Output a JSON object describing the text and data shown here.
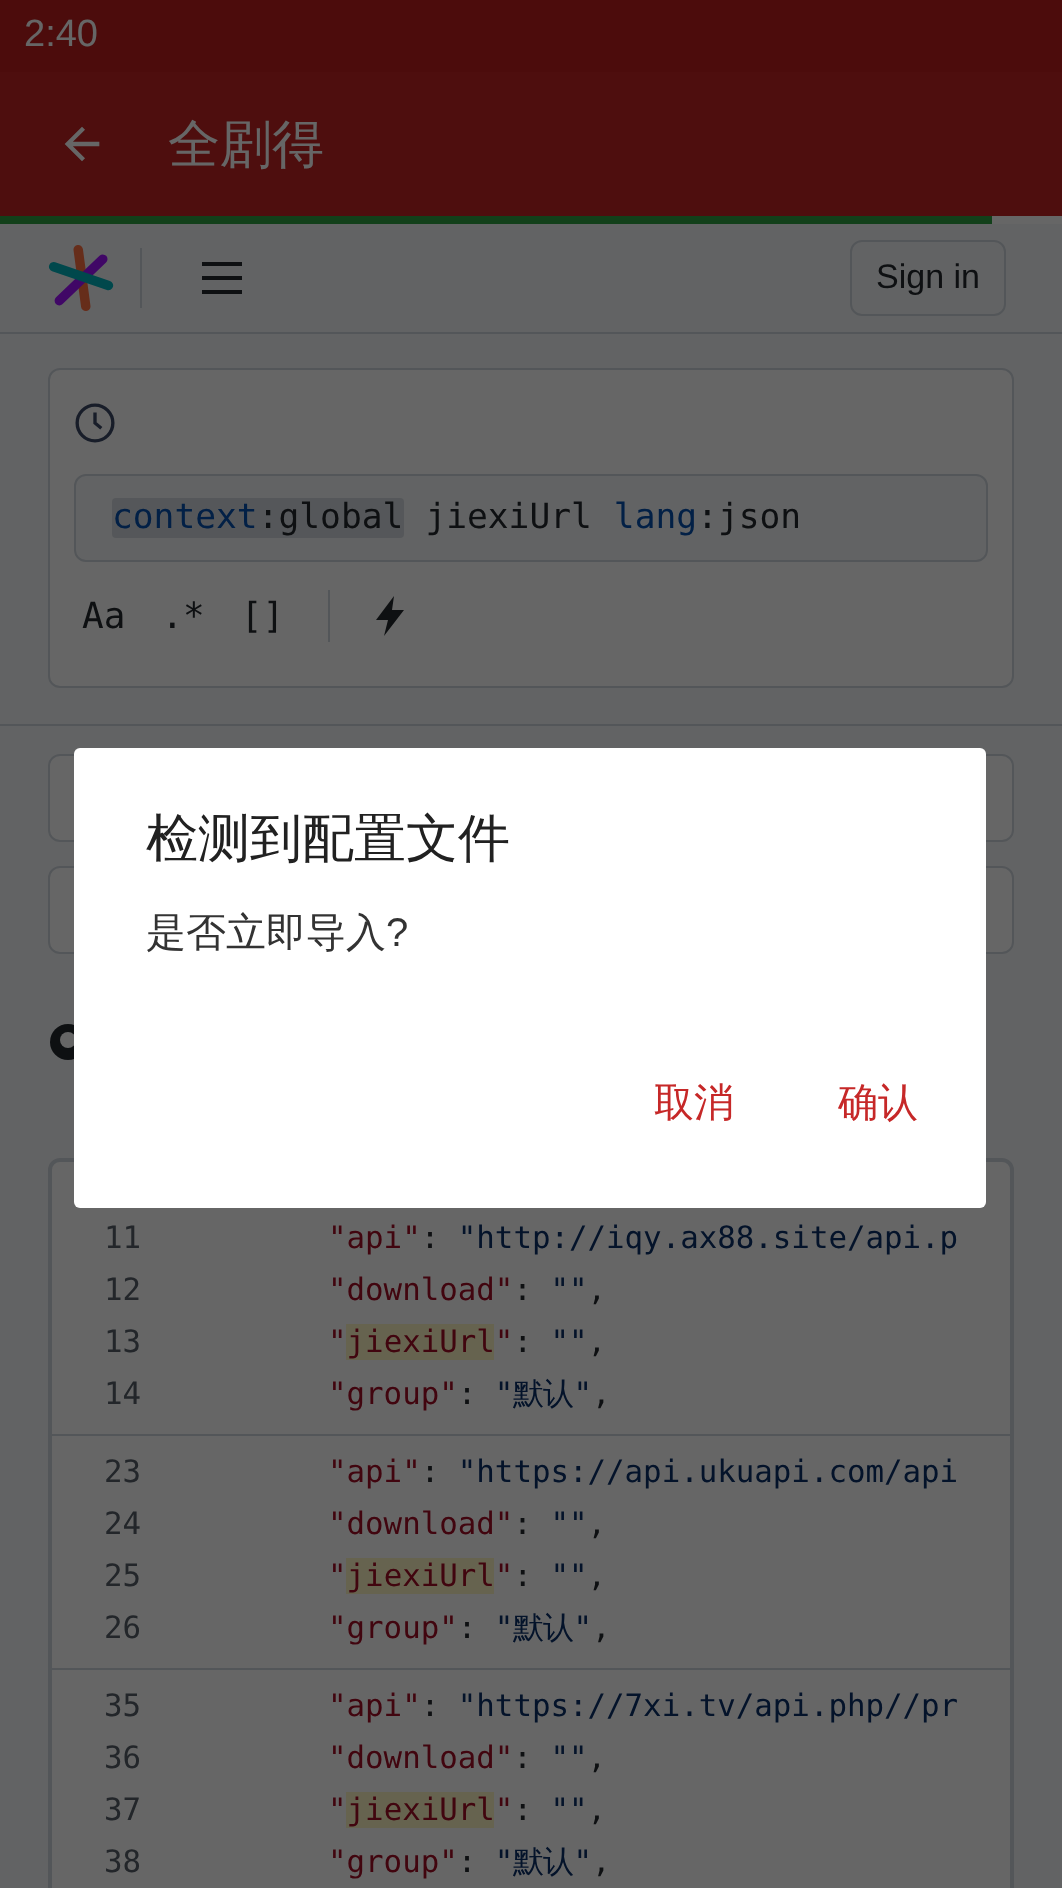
{
  "status_bar": {
    "time": "2:40"
  },
  "app_bar": {
    "title": "全剧得"
  },
  "page_progress": {
    "level": 0.935
  },
  "site_header": {
    "sign_in": "Sign in"
  },
  "search": {
    "query": [
      {
        "key": "context",
        "value": ":global",
        "chip": true
      },
      {
        "text": "jiexiUrl"
      },
      {
        "key": "lang",
        "value": ":json",
        "chip": false
      }
    ],
    "options": [
      "Aa",
      ".*",
      "[]"
    ]
  },
  "code_groups": [
    {
      "lines": [
        {
          "number": "11",
          "tokens": [
            {
              "kind": "key",
              "text": "\"api\""
            },
            {
              "kind": "punct",
              "text": ": "
            },
            {
              "kind": "string",
              "text": "\"http://iqy.ax88.site/api.p"
            }
          ]
        },
        {
          "number": "12",
          "tokens": [
            {
              "kind": "key",
              "text": "\"download\""
            },
            {
              "kind": "punct",
              "text": ": "
            },
            {
              "kind": "string",
              "text": "\"\""
            },
            {
              "kind": "punct",
              "text": ","
            }
          ]
        },
        {
          "number": "13",
          "tokens": [
            {
              "kind": "key",
              "text": "\""
            },
            {
              "kind": "match",
              "text": "jiexiUrl"
            },
            {
              "kind": "key",
              "text": "\""
            },
            {
              "kind": "punct",
              "text": ": "
            },
            {
              "kind": "string",
              "text": "\"\""
            },
            {
              "kind": "punct",
              "text": ","
            }
          ]
        },
        {
          "number": "14",
          "tokens": [
            {
              "kind": "key",
              "text": "\"group\""
            },
            {
              "kind": "punct",
              "text": ": "
            },
            {
              "kind": "string",
              "text": "\"默认\""
            },
            {
              "kind": "punct",
              "text": ","
            }
          ]
        }
      ]
    },
    {
      "lines": [
        {
          "number": "23",
          "tokens": [
            {
              "kind": "key",
              "text": "\"api\""
            },
            {
              "kind": "punct",
              "text": ": "
            },
            {
              "kind": "string",
              "text": "\"https://api.ukuapi.com/api"
            }
          ]
        },
        {
          "number": "24",
          "tokens": [
            {
              "kind": "key",
              "text": "\"download\""
            },
            {
              "kind": "punct",
              "text": ": "
            },
            {
              "kind": "string",
              "text": "\"\""
            },
            {
              "kind": "punct",
              "text": ","
            }
          ]
        },
        {
          "number": "25",
          "tokens": [
            {
              "kind": "key",
              "text": "\""
            },
            {
              "kind": "match",
              "text": "jiexiUrl"
            },
            {
              "kind": "key",
              "text": "\""
            },
            {
              "kind": "punct",
              "text": ": "
            },
            {
              "kind": "string",
              "text": "\"\""
            },
            {
              "kind": "punct",
              "text": ","
            }
          ]
        },
        {
          "number": "26",
          "tokens": [
            {
              "kind": "key",
              "text": "\"group\""
            },
            {
              "kind": "punct",
              "text": ": "
            },
            {
              "kind": "string",
              "text": "\"默认\""
            },
            {
              "kind": "punct",
              "text": ","
            }
          ]
        }
      ]
    },
    {
      "lines": [
        {
          "number": "35",
          "tokens": [
            {
              "kind": "key",
              "text": "\"api\""
            },
            {
              "kind": "punct",
              "text": ": "
            },
            {
              "kind": "string",
              "text": "\"https://7xi.tv/api.php//pr"
            }
          ]
        },
        {
          "number": "36",
          "tokens": [
            {
              "kind": "key",
              "text": "\"download\""
            },
            {
              "kind": "punct",
              "text": ": "
            },
            {
              "kind": "string",
              "text": "\"\""
            },
            {
              "kind": "punct",
              "text": ","
            }
          ]
        },
        {
          "number": "37",
          "tokens": [
            {
              "kind": "key",
              "text": "\""
            },
            {
              "kind": "match",
              "text": "jiexiUrl"
            },
            {
              "kind": "key",
              "text": "\""
            },
            {
              "kind": "punct",
              "text": ": "
            },
            {
              "kind": "string",
              "text": "\"\""
            },
            {
              "kind": "punct",
              "text": ","
            }
          ]
        },
        {
          "number": "38",
          "tokens": [
            {
              "kind": "key",
              "text": "\"group\""
            },
            {
              "kind": "punct",
              "text": ": "
            },
            {
              "kind": "string",
              "text": "\"默认\""
            },
            {
              "kind": "punct",
              "text": ","
            }
          ]
        }
      ]
    }
  ],
  "dialog": {
    "title": "检测到配置文件",
    "message": "是否立即导入?",
    "buttons": [
      "取消",
      "确认"
    ]
  }
}
